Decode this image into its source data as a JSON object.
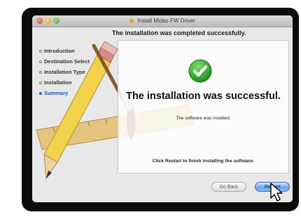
{
  "window": {
    "title": "Install Midas FW Driver"
  },
  "header": {
    "text": "The installation was completed successfully."
  },
  "sidebar": {
    "steps": [
      {
        "label": "Introduction",
        "active": false
      },
      {
        "label": "Destination Select",
        "active": false
      },
      {
        "label": "Installation Type",
        "active": false
      },
      {
        "label": "Installation",
        "active": false
      },
      {
        "label": "Summary",
        "active": true
      }
    ]
  },
  "panel": {
    "icon": "checkmark-icon",
    "success_text": "The installation was successful.",
    "installed_text": "The software was installed.",
    "restart_note": "Click Restart to finish installing the software."
  },
  "buttons": {
    "back_label": "Go Back",
    "restart_label": "Restart"
  },
  "colors": {
    "accent": "#2f66d8",
    "check_green": "#2fae2f"
  }
}
